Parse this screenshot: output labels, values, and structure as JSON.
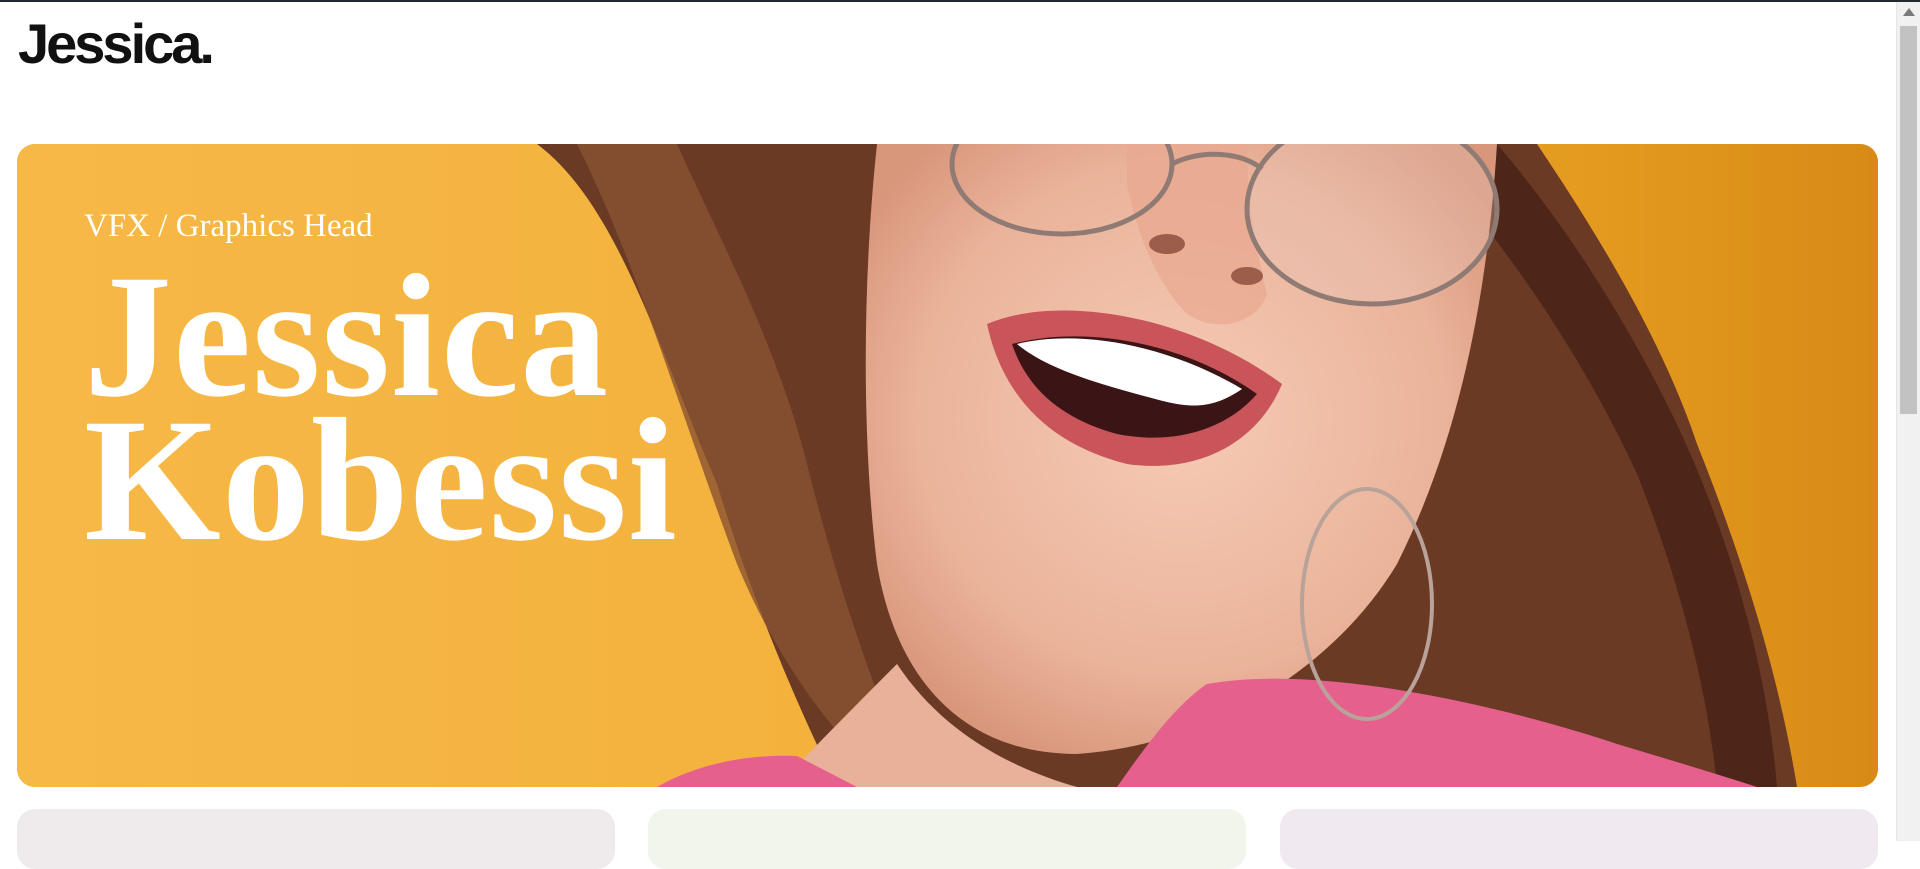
{
  "header": {
    "logo": "Jessica."
  },
  "hero": {
    "subtitle": "VFX / Graphics Head",
    "name_first": "Jessica",
    "name_last": "Kobessi",
    "image": "portrait-photo",
    "background_color": "#f2b23b"
  },
  "cards": [
    {
      "name": "card-1",
      "color": "#efeaec"
    },
    {
      "name": "card-2",
      "color": "#f1f5ec"
    },
    {
      "name": "card-3",
      "color": "#f0e9ef"
    }
  ],
  "scrollbar": {
    "icon": "arrow-up-icon"
  }
}
